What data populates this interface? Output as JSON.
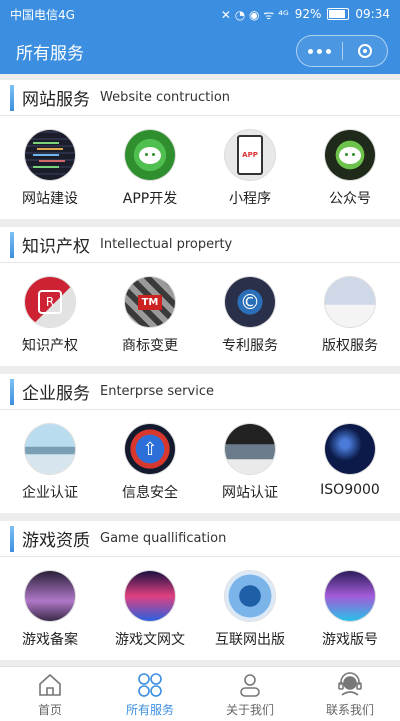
{
  "status": {
    "carrier": "中国电信4G",
    "battery": "92%",
    "time": "09:34"
  },
  "header": {
    "title": "所有服务"
  },
  "sections": [
    {
      "title": "网站服务",
      "subtitle": "Website contruction",
      "items": [
        {
          "label": "网站建设",
          "icon": "code-screen-icon"
        },
        {
          "label": "APP开发",
          "icon": "wechat-app-icon"
        },
        {
          "label": "小程序",
          "icon": "phone-app-icon"
        },
        {
          "label": "公众号",
          "icon": "wechat-official-icon"
        }
      ]
    },
    {
      "title": "知识产权",
      "subtitle": "Intellectual property",
      "items": [
        {
          "label": "知识产权",
          "icon": "ip-key-icon"
        },
        {
          "label": "商标变更",
          "icon": "trademark-icon"
        },
        {
          "label": "专利服务",
          "icon": "copyright-icon"
        },
        {
          "label": "版权服务",
          "icon": "book-icon"
        }
      ]
    },
    {
      "title": "企业服务",
      "subtitle": "Enterprse service",
      "items": [
        {
          "label": "企业认证",
          "icon": "city-icon"
        },
        {
          "label": "信息安全",
          "icon": "cloud-upload-icon"
        },
        {
          "label": "网站认证",
          "icon": "shield-laptop-icon"
        },
        {
          "label": "ISO9000",
          "icon": "network-globe-icon"
        }
      ]
    },
    {
      "title": "游戏资质",
      "subtitle": "Game quallification",
      "items": [
        {
          "label": "游戏备案",
          "icon": "game-character-icon"
        },
        {
          "label": "游戏文网文",
          "icon": "game-neon-icon"
        },
        {
          "label": "互联网出版",
          "icon": "globe-hand-icon"
        },
        {
          "label": "游戏版号",
          "icon": "game-arcade-icon"
        }
      ]
    }
  ],
  "tabbar": [
    {
      "label": "首页",
      "icon": "home-icon"
    },
    {
      "label": "所有服务",
      "icon": "grid-circles-icon"
    },
    {
      "label": "关于我们",
      "icon": "user-icon"
    },
    {
      "label": "联系我们",
      "icon": "headset-icon"
    }
  ],
  "colors": {
    "primary": "#3c8fe0",
    "background": "#ededed"
  }
}
